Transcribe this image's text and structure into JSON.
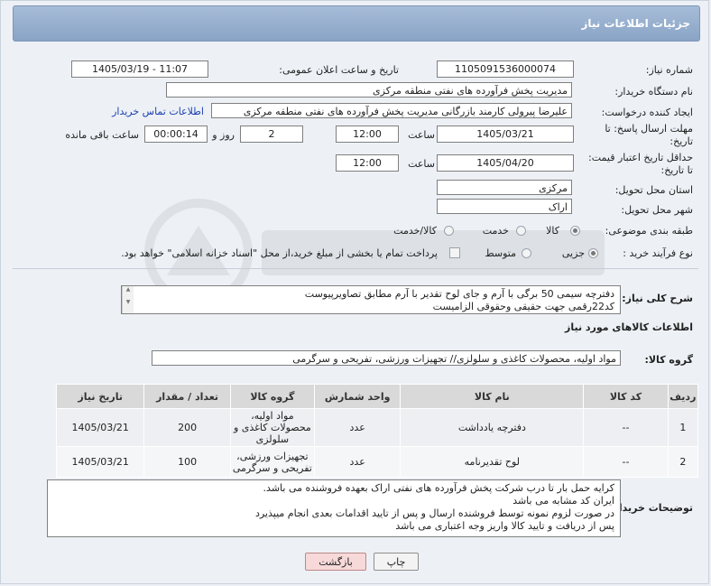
{
  "header": {
    "title": "جزئیات اطلاعات نیاز"
  },
  "need_number": {
    "label": "شماره نیاز:",
    "value": "1105091536000074"
  },
  "announce": {
    "label": "تاریخ و ساعت اعلان عمومی:",
    "value": "1405/03/19 - 11:07"
  },
  "buyer_org": {
    "label": "نام دستگاه خریدار:",
    "value": "مدیریت پخش فرآورده های نفتی منطقه مرکزی"
  },
  "requester": {
    "label": "ایجاد کننده درخواست:",
    "value": "علیرضا پیرولی کارمند بازرگانی مدیریت پخش فرآورده های نفتی منطقه مرکزی",
    "contact_link": "اطلاعات تماس خریدار"
  },
  "deadline": {
    "label": "مهلت ارسال پاسخ: تا تاریخ:",
    "date": "1405/03/21",
    "time_label": "ساعت",
    "time": "12:00",
    "days": "2",
    "days_label": "روز و",
    "remaining": "00:00:14",
    "remaining_label": "ساعت باقی مانده"
  },
  "validity": {
    "label": "حداقل تاریخ اعتبار قیمت: تا تاریخ:",
    "date": "1405/04/20",
    "time_label": "ساعت",
    "time": "12:00"
  },
  "province": {
    "label": "استان محل تحویل:",
    "value": "مرکزی"
  },
  "city": {
    "label": "شهر محل تحویل:",
    "value": "اراک"
  },
  "category": {
    "label": "طبقه بندی موضوعی:",
    "options": [
      "کالا",
      "خدمت",
      "کالا/خدمت"
    ],
    "selected": "کالا"
  },
  "process": {
    "label": "نوع فرآیند خرید :",
    "options": [
      "جزیی",
      "متوسط"
    ],
    "selected": "جزیی",
    "treasury_note": "پرداخت تمام یا بخشی از مبلغ خرید،از محل \"اسناد خزانه اسلامی\" خواهد بود."
  },
  "description": {
    "label": "شرح کلی نیاز:",
    "lines": [
      "دفترچه سیمی 50 برگی با آرم و جای لوح تقدیر با آرم مطابق  تصاویرپیوست",
      "کد22رقمی جهت حقیقی وحقوقی الزامیست"
    ]
  },
  "goods_section": {
    "title": "اطلاعات کالاهای مورد نیاز"
  },
  "goods_group": {
    "label": "گروه کالا:",
    "value": "مواد اولیه، محصولات کاغذی و سلولزی// تجهیزات ورزشی، تفریحی و سرگرمی"
  },
  "table": {
    "headers": [
      "ردیف",
      "کد کالا",
      "نام کالا",
      "واحد شمارش",
      "گروه کالا",
      "تعداد / مقدار",
      "تاریخ نیاز"
    ],
    "rows": [
      {
        "row": "1",
        "code": "--",
        "name": "دفترچه یادداشت",
        "unit": "عدد",
        "group_lines": [
          "مواد اولیه،",
          "محصولات کاغذی و",
          "سلولزی"
        ],
        "qty": "200",
        "date": "1405/03/21"
      },
      {
        "row": "2",
        "code": "--",
        "name": "لوح تقدیرنامه",
        "unit": "عدد",
        "group_lines": [
          "تجهیزات ورزشی،",
          "تفریحی و سرگرمی"
        ],
        "qty": "100",
        "date": "1405/03/21"
      }
    ]
  },
  "buyer_notes": {
    "label": "توضیحات خریدار:",
    "lines": [
      "کرایه حمل بار تا درب شرکت  پخش فرآورده های نفتی اراک بعهده فروشنده می باشد.",
      "ایران کد مشابه می باشد",
      "در صورت لزوم نمونه توسط فروشنده ارسال و پس از تایید اقدامات بعدی انجام میپذیرد",
      "پس از دریافت و تایید کالا واریز وجه اعتباری می باشد"
    ]
  },
  "buttons": {
    "print": "چاپ",
    "back": "بازگشت"
  },
  "colors": {
    "header_bg": "#8aa4c6",
    "table_header": "#d9d9d9",
    "back_button": "#f7d9d9",
    "link": "#1a3fb0"
  }
}
